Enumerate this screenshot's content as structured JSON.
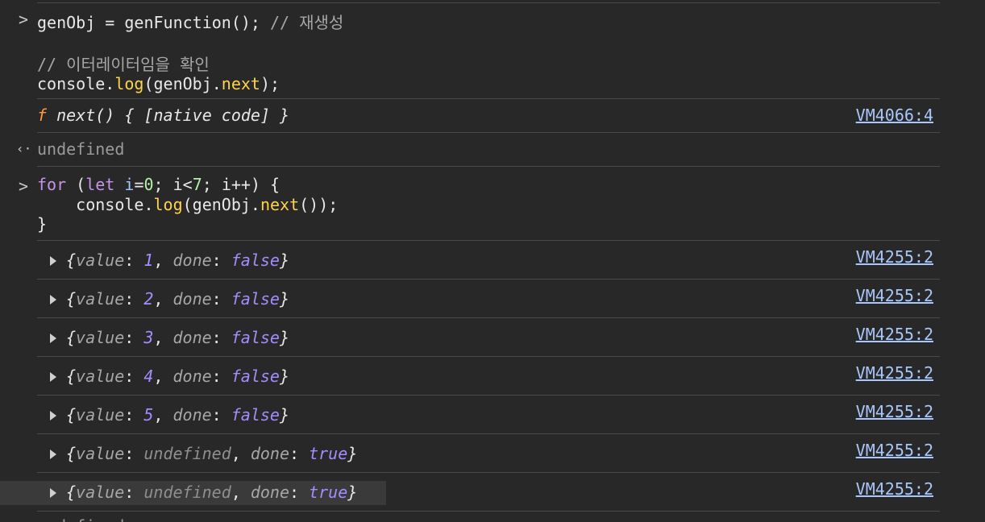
{
  "prompt_symbol": ">",
  "result_symbol": "‹·",
  "input1": {
    "line1": {
      "a": "genObj = ",
      "b": "genFunction",
      "c": "(); ",
      "d": "// 재생성"
    },
    "line2": "// 이터레이터임을 확인",
    "line3": {
      "a": "console.",
      "b": "log",
      "c": "(genObj.",
      "d": "next",
      "e": ");"
    }
  },
  "output_fn": {
    "f": "f",
    "text": " next() { [native code] }",
    "source": "VM4066:4"
  },
  "return1": "undefined",
  "input2": {
    "l1": {
      "kw1": "for",
      "a": " (",
      "kw2": "let",
      "b": " ",
      "var": "i",
      "c": "=",
      "n0": "0",
      "d": "; i<",
      "n7": "7",
      "e": "; i++) {"
    },
    "l2": {
      "indent": "    ",
      "a": "console.",
      "b": "log",
      "c": "(genObj.",
      "d": "next",
      "e": "());"
    },
    "l3": "}"
  },
  "results": [
    {
      "value": "1",
      "done": "false",
      "source": "VM4255:2"
    },
    {
      "value": "2",
      "done": "false",
      "source": "VM4255:2"
    },
    {
      "value": "3",
      "done": "false",
      "source": "VM4255:2"
    },
    {
      "value": "4",
      "done": "false",
      "source": "VM4255:2"
    },
    {
      "value": "5",
      "done": "false",
      "source": "VM4255:2"
    },
    {
      "value": "undefined",
      "done": "true",
      "source": "VM4255:2"
    },
    {
      "value": "undefined",
      "done": "true",
      "source": "VM4255:2"
    }
  ],
  "obj_keys": {
    "open": "{",
    "value_key": "value",
    "sep": ": ",
    "comma": ", ",
    "done_key": "done",
    "close": "}"
  },
  "return2_partial": "undefined"
}
